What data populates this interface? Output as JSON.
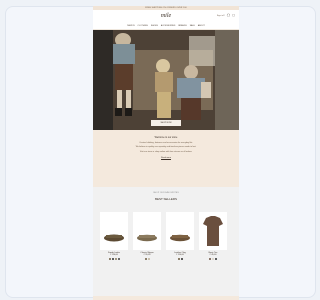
{
  "announcement": "FREE SHIPPING ON ORDERS OVER 100",
  "header": {
    "logo": "mile",
    "meta": "Sign in",
    "icons": [
      "search-icon",
      "account-icon",
      "cart-icon"
    ]
  },
  "nav": [
    "NEW IN",
    "CLOTHING",
    "SHOES",
    "ACCESSORIES",
    "BRANDS",
    "SALE",
    "ABOUT"
  ],
  "hero": {
    "button": "SHOP NOW"
  },
  "intro": {
    "headline": "Welcome to our store",
    "lines": [
      "Curated clothing, footwear and accessories for everyday life.",
      "We believe in quality over quantity and timeless pieces made to last.",
      "Visit our store or shop online with free returns on all orders."
    ],
    "link": "Read more"
  },
  "products": {
    "kicker": "SHOP OUR FAVOURITES",
    "title": "BEST SELLERS",
    "items": [
      {
        "name": "Suede Loafer",
        "price": "€ 120,00",
        "swatches": [
          "#6b5a3e",
          "#2d2d2d",
          "#8a7a5c",
          "#3f3f3f"
        ]
      },
      {
        "name": "Classic Slipper",
        "price": "€ 95,00",
        "swatches": [
          "#6b5a3e",
          "#bdb29a"
        ]
      },
      {
        "name": "Leather Clog",
        "price": "€ 110,00",
        "swatches": [
          "#6b5a3e",
          "#2d2d2d"
        ]
      },
      {
        "name": "Basic Tee",
        "price": "€ 45,00",
        "swatches": [
          "#6a4f3e",
          "#d9cfc2",
          "#2d2d2d"
        ]
      }
    ]
  },
  "colors": {
    "accent": "#f4e9dd",
    "text": "#3a2f26"
  }
}
